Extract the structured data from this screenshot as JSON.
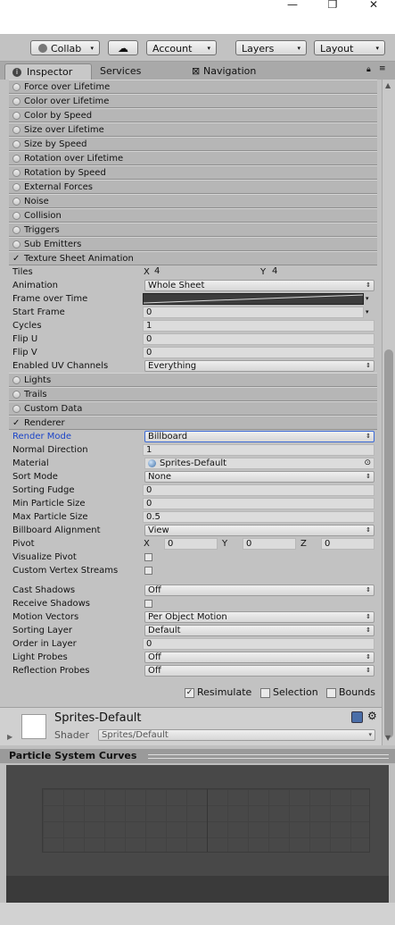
{
  "window": {
    "minimize": "—",
    "restore": "❐",
    "close": "✕"
  },
  "toolbar": {
    "collab": "Collab",
    "cloud": "☁",
    "account": "Account",
    "layers": "Layers",
    "layout": "Layout",
    "arrow": "▾"
  },
  "tabs": {
    "inspector": "Inspector",
    "services": "Services",
    "navigation": "Navigation"
  },
  "modules_top": [
    "Force over Lifetime",
    "Color over Lifetime",
    "Color by Speed",
    "Size over Lifetime",
    "Size by Speed",
    "Rotation over Lifetime",
    "Rotation by Speed",
    "External Forces",
    "Noise",
    "Collision",
    "Triggers",
    "Sub Emitters"
  ],
  "texture_sheet": {
    "header": "Texture Sheet Animation",
    "tiles": {
      "label": "Tiles",
      "x_label": "X",
      "x": "4",
      "y_label": "Y",
      "y": "4"
    },
    "animation": {
      "label": "Animation",
      "value": "Whole Sheet"
    },
    "frame_over_time": {
      "label": "Frame over Time"
    },
    "start_frame": {
      "label": "Start Frame",
      "value": "0"
    },
    "cycles": {
      "label": "Cycles",
      "value": "1"
    },
    "flip_u": {
      "label": "Flip U",
      "value": "0"
    },
    "flip_v": {
      "label": "Flip V",
      "value": "0"
    },
    "uv_channels": {
      "label": "Enabled UV Channels",
      "value": "Everything"
    }
  },
  "modules_mid": [
    "Lights",
    "Trails",
    "Custom Data"
  ],
  "renderer": {
    "header": "Renderer",
    "render_mode": {
      "label": "Render Mode",
      "value": "Billboard"
    },
    "normal_direction": {
      "label": "Normal Direction",
      "value": "1"
    },
    "material": {
      "label": "Material",
      "value": "Sprites-Default"
    },
    "sort_mode": {
      "label": "Sort Mode",
      "value": "None"
    },
    "sorting_fudge": {
      "label": "Sorting Fudge",
      "value": "0"
    },
    "min_particle": {
      "label": "Min Particle Size",
      "value": "0"
    },
    "max_particle": {
      "label": "Max Particle Size",
      "value": "0.5"
    },
    "billboard_alignment": {
      "label": "Billboard Alignment",
      "value": "View"
    },
    "pivot": {
      "label": "Pivot",
      "x_label": "X",
      "x": "0",
      "y_label": "Y",
      "y": "0",
      "z_label": "Z",
      "z": "0"
    },
    "visualize_pivot": {
      "label": "Visualize Pivot"
    },
    "custom_vertex": {
      "label": "Custom Vertex Streams"
    },
    "cast_shadows": {
      "label": "Cast Shadows",
      "value": "Off"
    },
    "receive_shadows": {
      "label": "Receive Shadows"
    },
    "motion_vectors": {
      "label": "Motion Vectors",
      "value": "Per Object Motion"
    },
    "sorting_layer": {
      "label": "Sorting Layer",
      "value": "Default"
    },
    "order_in_layer": {
      "label": "Order in Layer",
      "value": "0"
    },
    "light_probes": {
      "label": "Light Probes",
      "value": "Off"
    },
    "reflection_probes": {
      "label": "Reflection Probes",
      "value": "Off"
    }
  },
  "options": {
    "resimulate": "Resimulate",
    "selection": "Selection",
    "bounds": "Bounds"
  },
  "material_panel": {
    "name": "Sprites-Default",
    "shader_label": "Shader",
    "shader_value": "Sprites/Default"
  },
  "curves": {
    "title": "Particle System Curves"
  },
  "icons": {
    "check": "✓",
    "dropdown": "▾",
    "updown": "⇕",
    "target": "⊙",
    "foldout": "▶",
    "scroll_up": "▲",
    "scroll_down": "▼"
  }
}
